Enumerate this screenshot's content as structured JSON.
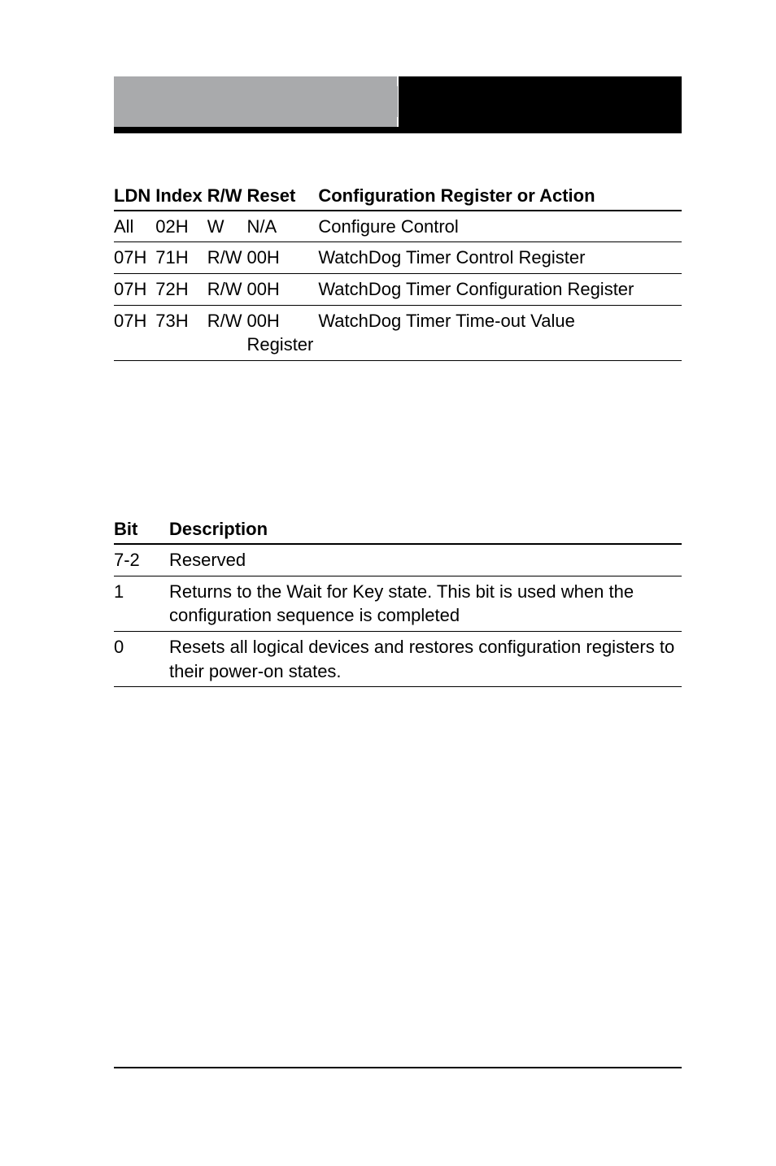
{
  "reg_table": {
    "headers": {
      "ldn": "LDN",
      "index": "Index",
      "rw": "R/W",
      "reset": "Reset",
      "config": "Configuration Register or Action"
    },
    "rows": [
      {
        "ldn": "All",
        "index": "02H",
        "rw": "W",
        "reset": "N/A",
        "config": "Configure Control"
      },
      {
        "ldn": "07H",
        "index": "71H",
        "rw": "R/W",
        "reset": "00H",
        "config": "WatchDog Timer Control Register"
      },
      {
        "ldn": "07H",
        "index": "72H",
        "rw": "R/W",
        "reset": "00H",
        "config": "WatchDog Timer Configuration Register"
      },
      {
        "ldn": "07H",
        "index": "73H",
        "rw": "R/W",
        "reset": "00H Register",
        "config": "WatchDog Timer Time-out Value"
      }
    ]
  },
  "bit_table": {
    "headers": {
      "bit": "Bit",
      "desc": "Description"
    },
    "rows": [
      {
        "bit": "7-2",
        "desc": "Reserved"
      },
      {
        "bit": "1",
        "desc": "Returns to the Wait for Key state. This bit is used when the configuration sequence is completed"
      },
      {
        "bit": "0",
        "desc": "Resets all logical devices and restores configuration registers to their power-on states."
      }
    ]
  }
}
